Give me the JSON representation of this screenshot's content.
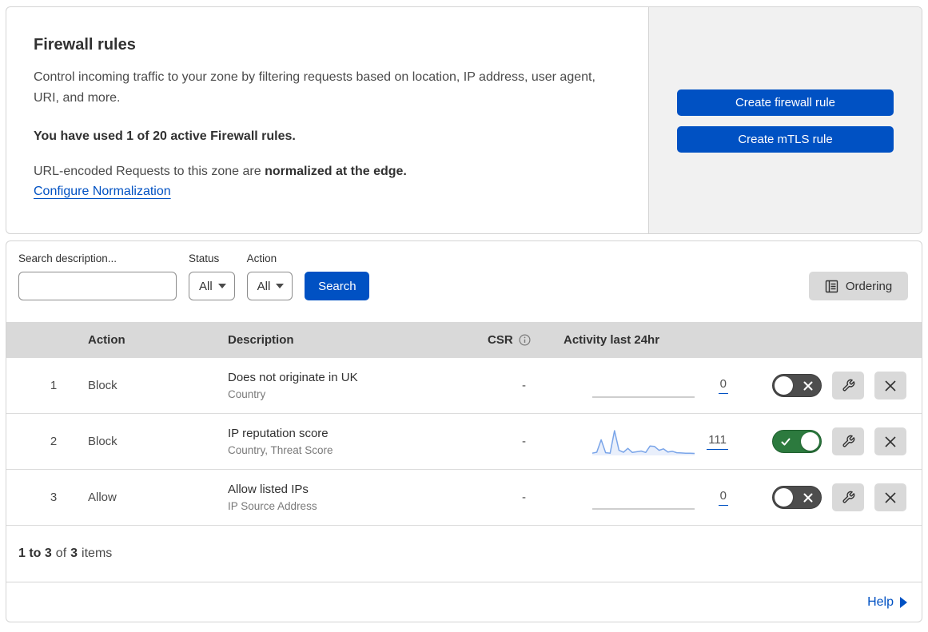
{
  "header": {
    "title": "Firewall rules",
    "description": "Control incoming traffic to your zone by filtering requests based on location, IP address, user agent, URI, and more.",
    "usage_line": "You have used 1 of 20 active Firewall rules.",
    "normalization_prefix": "URL-encoded Requests to this zone are ",
    "normalization_bold": "normalized at the edge.",
    "normalization_link": "Configure Normalization",
    "create_firewall_button": "Create firewall rule",
    "create_mtls_button": "Create mTLS rule"
  },
  "filters": {
    "search_label": "Search description...",
    "status_label": "Status",
    "status_value": "All",
    "action_label": "Action",
    "action_value": "All",
    "search_button": "Search",
    "ordering_button": "Ordering"
  },
  "table": {
    "columns": {
      "action": "Action",
      "description": "Description",
      "csr": "CSR",
      "activity": "Activity last 24hr"
    }
  },
  "rules": [
    {
      "priority": "1",
      "action": "Block",
      "description": "Does not originate in UK",
      "fields": "Country",
      "csr": "-",
      "activity_count": "0",
      "enabled": false,
      "sparkline": null
    },
    {
      "priority": "2",
      "action": "Block",
      "description": "IP reputation score",
      "fields": "Country, Threat Score",
      "csr": "-",
      "activity_count": "111",
      "enabled": true,
      "sparkline": [
        6,
        10,
        62,
        8,
        6,
        100,
        18,
        10,
        26,
        9,
        12,
        15,
        9,
        36,
        34,
        18,
        24,
        11,
        14,
        8,
        7,
        6,
        6,
        5
      ]
    },
    {
      "priority": "3",
      "action": "Allow",
      "description": "Allow listed IPs",
      "fields": "IP Source Address",
      "csr": "-",
      "activity_count": "0",
      "enabled": false,
      "sparkline": null
    }
  ],
  "pagination": {
    "range": "1 to 3",
    "of_word": "of",
    "total": "3",
    "items_word": "items"
  },
  "footer": {
    "help_label": "Help"
  },
  "colors": {
    "accent_blue": "#0051c3",
    "toggle_on_green": "#2c7a3e",
    "toggle_off_gray": "#4d4d4d",
    "sparkline_blue": "#7aa5e9",
    "sparkline_fill": "#e9effb",
    "panel_gray": "#f1f1f1",
    "table_header_gray": "#d9d9d9"
  }
}
